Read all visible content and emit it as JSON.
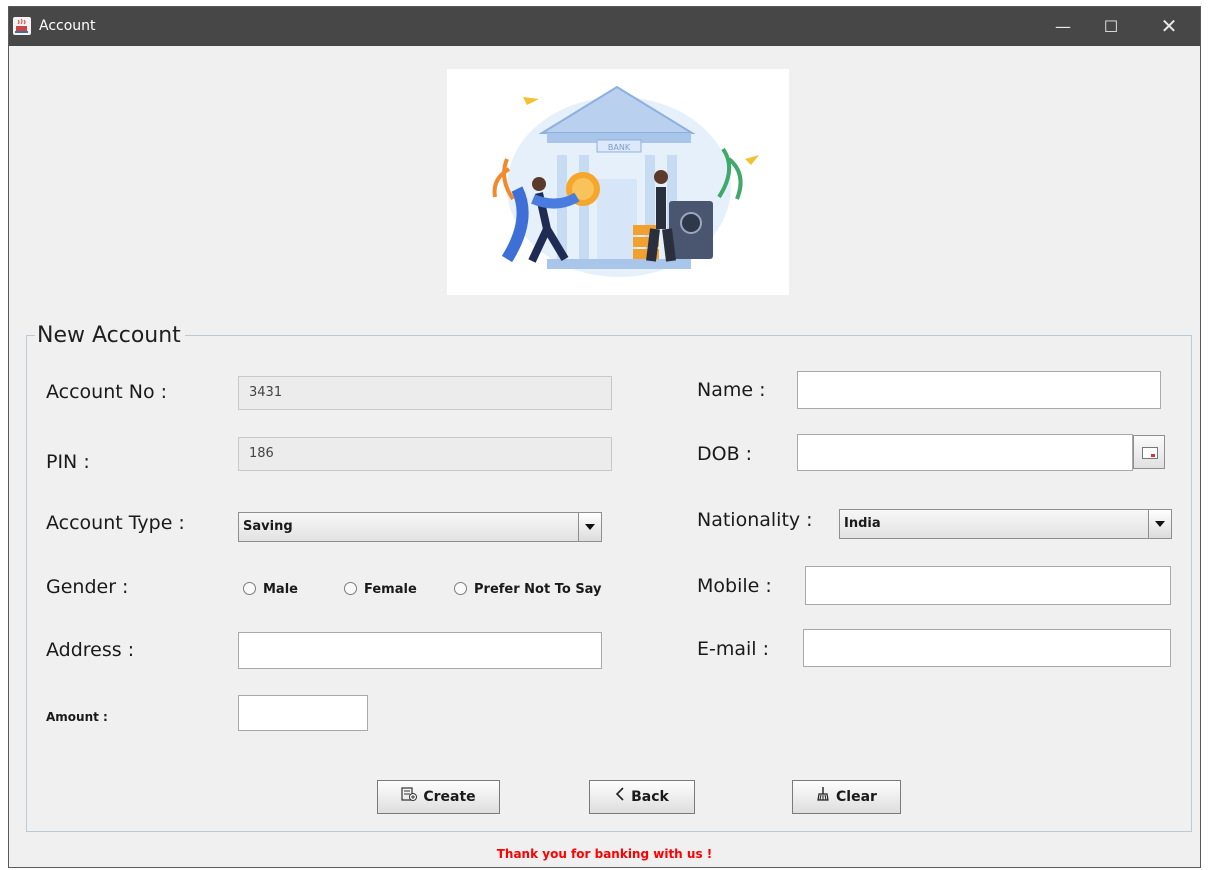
{
  "window": {
    "title": "Account",
    "controls": {
      "minimize": "—",
      "maximize": "☐",
      "close": "✕"
    }
  },
  "form": {
    "legend": "New Account",
    "account_no": {
      "label": "Account No :",
      "value": "3431"
    },
    "pin": {
      "label": "PIN :",
      "value": "186"
    },
    "account_type": {
      "label": "Account Type :",
      "value": "Saving"
    },
    "gender": {
      "label": "Gender :",
      "options": [
        "Male",
        "Female",
        "Prefer Not To Say"
      ]
    },
    "address": {
      "label": "Address :",
      "value": ""
    },
    "amount": {
      "label": "Amount :",
      "value": ""
    },
    "name": {
      "label": "Name :",
      "value": ""
    },
    "dob": {
      "label": "DOB :",
      "value": ""
    },
    "nationality": {
      "label": "Nationality :",
      "value": "India"
    },
    "mobile": {
      "label": "Mobile :",
      "value": ""
    },
    "email": {
      "label": "E-mail :",
      "value": ""
    }
  },
  "buttons": {
    "create": "Create",
    "back": "Back",
    "clear": "Clear"
  },
  "footer": {
    "message": "Thank you for banking with us !"
  },
  "image": {
    "bank_sign": "BANK"
  },
  "colors": {
    "footer_text": "#ff0000",
    "titlebar": "#474747",
    "window_bg": "#f0f0f0"
  }
}
